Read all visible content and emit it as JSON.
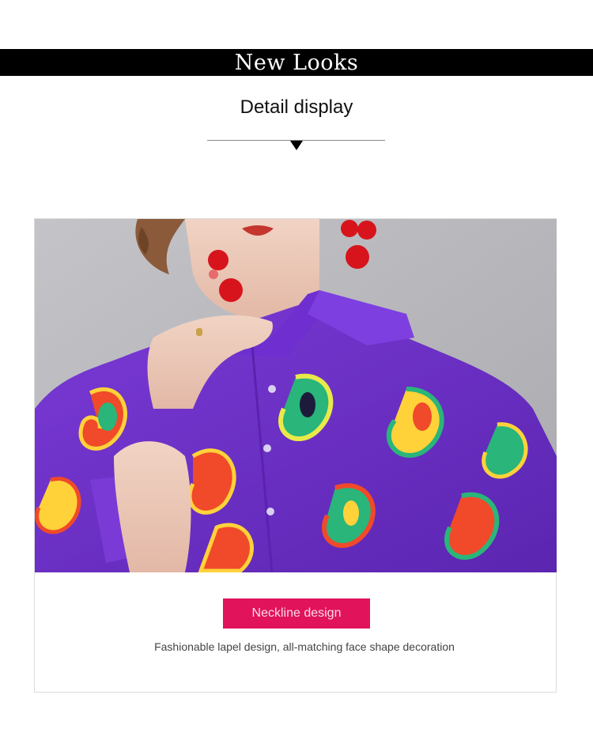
{
  "header": {
    "banner_title": "New Looks",
    "subtitle": "Detail display"
  },
  "detail_card": {
    "photo_icon": "model-in-purple-paisley-shirt",
    "tag_label": "Neckline design",
    "caption": "Fashionable lapel design, all-matching face shape decoration"
  },
  "colors": {
    "banner_bg": "#000000",
    "tag_bg": "#e0135b",
    "shirt_purple": "#6a2fc2"
  }
}
